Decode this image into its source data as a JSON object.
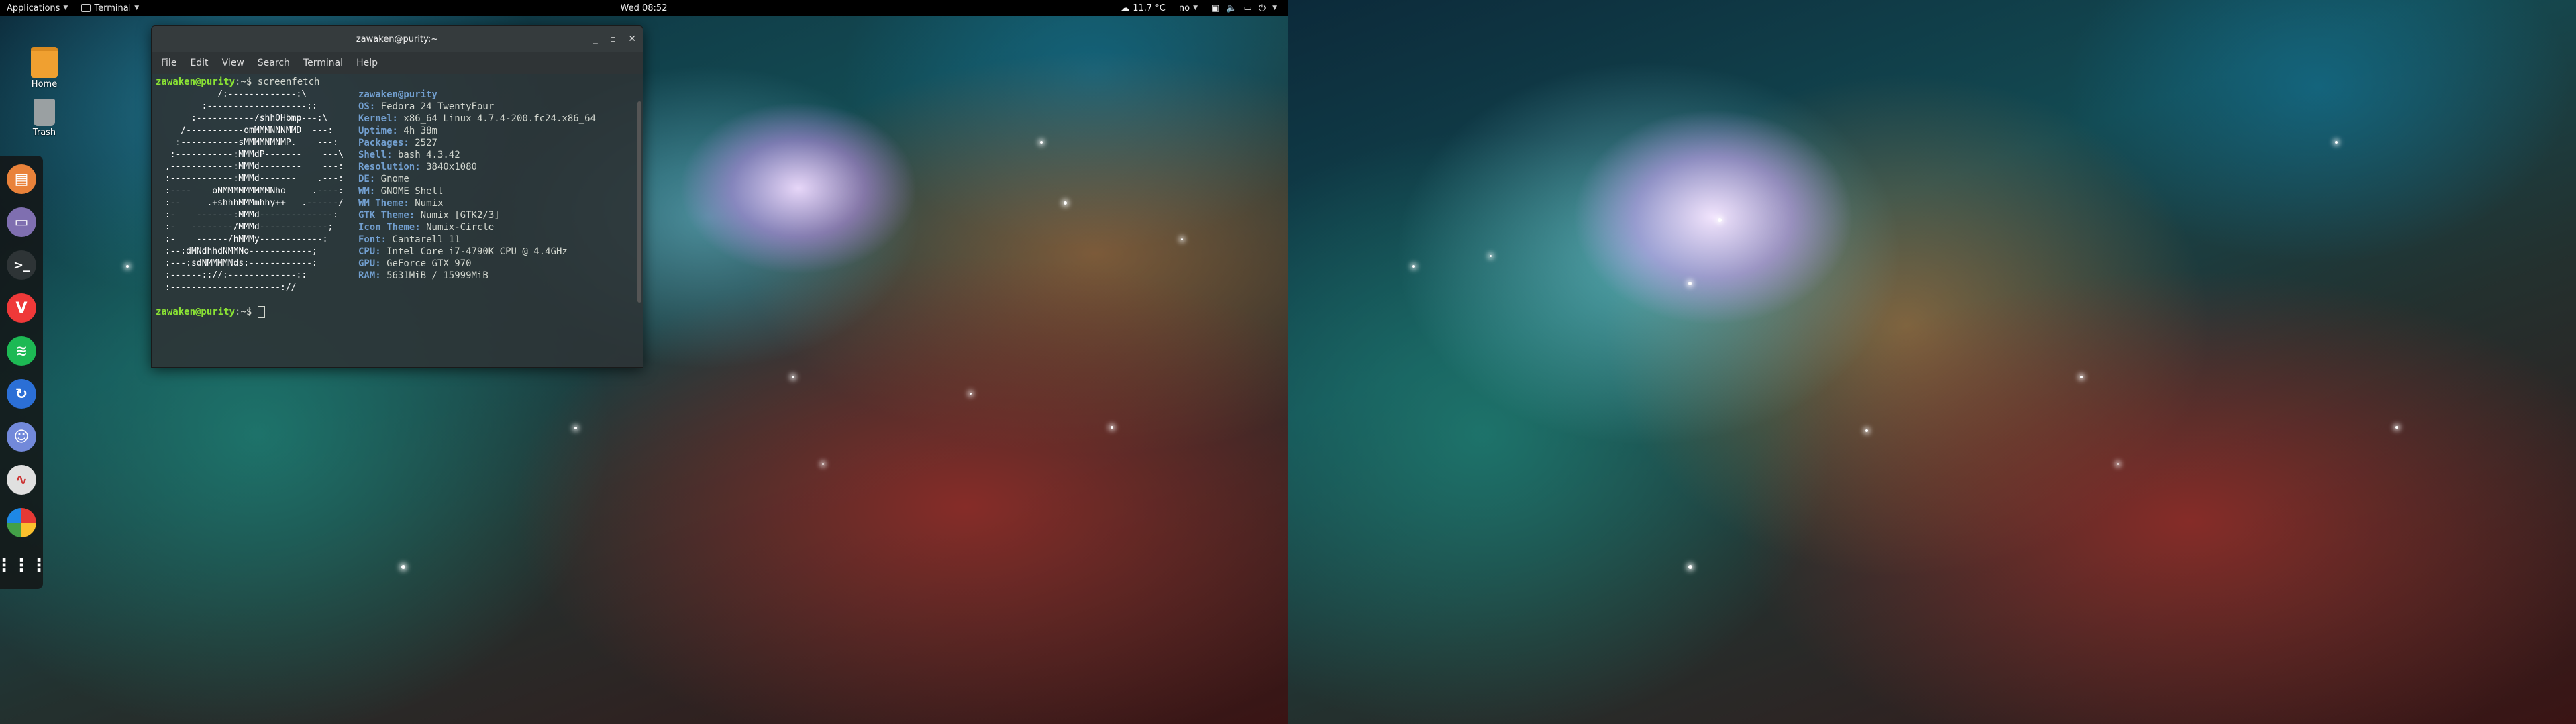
{
  "topbar": {
    "applications": "Applications",
    "active_app": "Terminal",
    "clock": "Wed 08:52",
    "weather": "11.7 °C",
    "keyboard": "no"
  },
  "desktop_icons": [
    {
      "label": "Home"
    },
    {
      "label": "Trash"
    }
  ],
  "dock": {
    "apps": [
      {
        "name": "files",
        "color": "#e9823a"
      },
      {
        "name": "document-viewer",
        "color": "#7f6fb0"
      },
      {
        "name": "terminal",
        "color": "#2e3436"
      },
      {
        "name": "vivaldi",
        "color": "#ef3939"
      },
      {
        "name": "spotify",
        "color": "#1db954"
      },
      {
        "name": "synchronization",
        "color": "#2b6fd6"
      },
      {
        "name": "discord",
        "color": "#7289da"
      },
      {
        "name": "system-monitor",
        "color": "#e0e0e0"
      },
      {
        "name": "photos",
        "color": "#444"
      },
      {
        "name": "show-applications",
        "color": "#444"
      }
    ]
  },
  "terminal": {
    "title": "zawaken@purity:~",
    "menu": [
      "File",
      "Edit",
      "View",
      "Search",
      "Terminal",
      "Help"
    ],
    "prompt_user": "zawaken@purity",
    "prompt_suffix": ":~$ ",
    "command": "screenfetch",
    "ascii_art": "           /:-------------:\\\n        :-------------------::\n      :-----------/shhOHbmp---:\\\n    /-----------omMMMNNNMMD  ---:\n   :-----------sMMMMNMNMP.    ---:\n  :-----------:MMMdP-------    ---\\\n ,------------:MMMd--------    ---:\n :------------:MMMd-------    .---:\n :----    oNMMMMMMMMMNho     .----:\n :--     .+shhhMMMmhhy++   .------/\n :-    -------:MMMd--------------:\n :-   --------/MMMd-------------;\n :-    ------/hMMMy------------:\n :--:dMNdhhdNMMNo------------;\n :---:sdNMMMMNds:------------:\n :------:://:-------------::\n :---------------------://",
    "info_header": "zawaken@purity",
    "info": [
      {
        "key": "OS:",
        "value": "Fedora 24 TwentyFour"
      },
      {
        "key": "Kernel:",
        "value": "x86_64 Linux 4.7.4-200.fc24.x86_64"
      },
      {
        "key": "Uptime:",
        "value": "4h 38m"
      },
      {
        "key": "Packages:",
        "value": "2527"
      },
      {
        "key": "Shell:",
        "value": "bash 4.3.42"
      },
      {
        "key": "Resolution:",
        "value": "3840x1080"
      },
      {
        "key": "DE:",
        "value": "Gnome"
      },
      {
        "key": "WM:",
        "value": "GNOME Shell"
      },
      {
        "key": "WM Theme:",
        "value": "Numix"
      },
      {
        "key": "GTK Theme:",
        "value": "Numix [GTK2/3]"
      },
      {
        "key": "Icon Theme:",
        "value": "Numix-Circle"
      },
      {
        "key": "Font:",
        "value": "Cantarell 11"
      },
      {
        "key": "CPU:",
        "value": "Intel Core i7-4790K CPU @ 4.4GHz"
      },
      {
        "key": "GPU:",
        "value": "GeForce GTX 970"
      },
      {
        "key": "RAM:",
        "value": "5631MiB / 15999MiB"
      }
    ]
  }
}
